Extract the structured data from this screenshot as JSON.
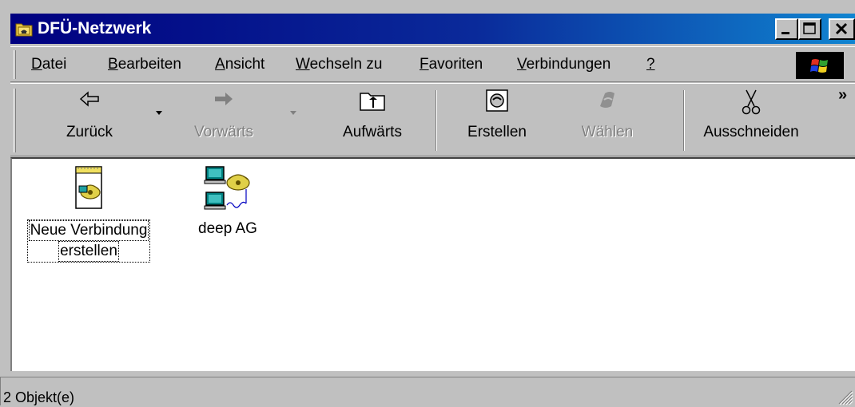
{
  "window": {
    "title": "DFÜ-Netzwerk",
    "icon": "dialup-folder-icon",
    "controls": [
      "minimize",
      "maximize",
      "close"
    ]
  },
  "menu": {
    "items": [
      {
        "label": "Datei",
        "accel": "D"
      },
      {
        "label": "Bearbeiten",
        "accel": "B"
      },
      {
        "label": "Ansicht",
        "accel": "A"
      },
      {
        "label": "Wechseln zu",
        "accel": "W"
      },
      {
        "label": "Favoriten",
        "accel": "F"
      },
      {
        "label": "Verbindungen",
        "accel": "V"
      },
      {
        "label": "?",
        "accel": "?"
      }
    ]
  },
  "toolbar": {
    "back": {
      "label": "Zurück",
      "icon": "back-arrow-icon",
      "enabled": true
    },
    "forward": {
      "label": "Vorwärts",
      "icon": "forward-arrow-icon",
      "enabled": false
    },
    "up": {
      "label": "Aufwärts",
      "icon": "up-folder-icon",
      "enabled": true
    },
    "create": {
      "label": "Erstellen",
      "icon": "create-connection-icon",
      "enabled": true
    },
    "dial": {
      "label": "Wählen",
      "icon": "dial-icon",
      "enabled": false
    },
    "cut": {
      "label": "Ausschneiden",
      "icon": "scissors-icon",
      "enabled": true
    },
    "more": "»"
  },
  "items": [
    {
      "line1": "Neue Verbindung",
      "line2": "erstellen",
      "icon": "new-connection-icon",
      "selected": true
    },
    {
      "line1": "deep AG",
      "line2": "",
      "icon": "dialup-connection-icon",
      "selected": false
    }
  ],
  "status": {
    "text": "2 Objekt(e)"
  },
  "colors": {
    "title_start": "#000080",
    "title_end": "#1084d0",
    "face": "#c0c0c0"
  }
}
